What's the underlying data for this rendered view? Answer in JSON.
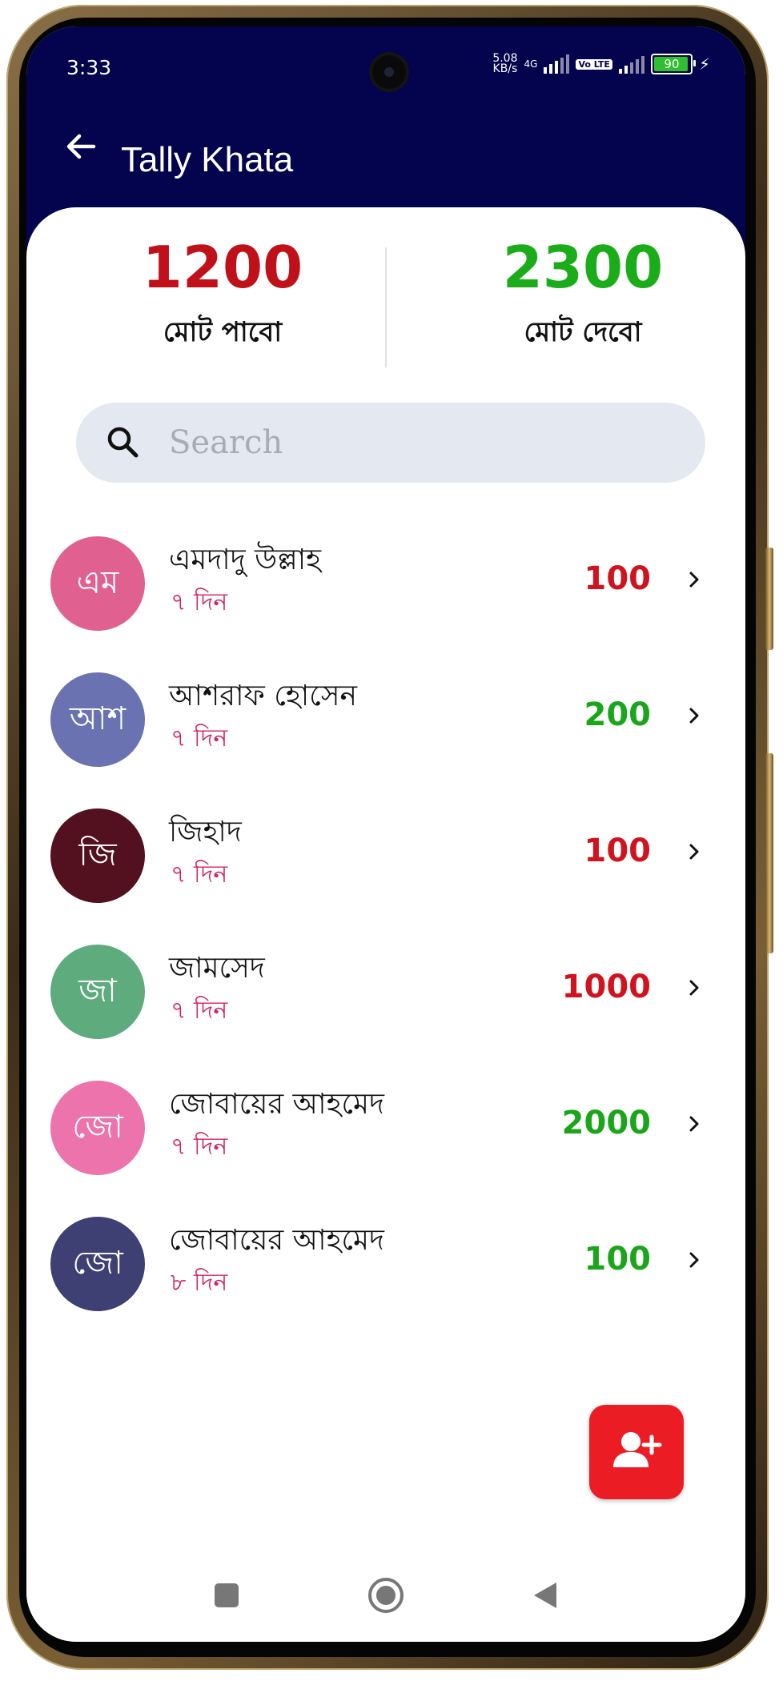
{
  "status": {
    "time": "3:33",
    "speed_top": "5.08",
    "speed_bottom": "KB/s",
    "network": "4G",
    "volte": "Vo LTE",
    "battery": "90"
  },
  "header": {
    "title": "Tally Khata"
  },
  "totals": {
    "receive": {
      "value": "1200",
      "label": "মোট পাবো",
      "color": "#c0101a"
    },
    "give": {
      "value": "2300",
      "label": "মোট দেবো",
      "color": "#1aad19"
    }
  },
  "search": {
    "placeholder": "Search"
  },
  "contacts": [
    {
      "initials": "এম",
      "name": "এমদাদু উল্লাহ",
      "days": "৭ দিন",
      "amount": "100",
      "amount_color": "#d0141f",
      "avatar_color": "#e0618f"
    },
    {
      "initials": "আশ",
      "name": "আশরাফ হোসেন",
      "days": "৭ দিন",
      "amount": "200",
      "amount_color": "#1aa51a",
      "avatar_color": "#6a72b2"
    },
    {
      "initials": "জি",
      "name": "জিহাদ",
      "days": "৭ দিন",
      "amount": "100",
      "amount_color": "#d0141f",
      "avatar_color": "#53101e"
    },
    {
      "initials": "জা",
      "name": "জামসেদ",
      "days": "৭ দিন",
      "amount": "1000",
      "amount_color": "#d0141f",
      "avatar_color": "#5eab7d"
    },
    {
      "initials": "জো",
      "name": "জোবায়ের আহমেদ",
      "days": "৭ দিন",
      "amount": "2000",
      "amount_color": "#1aa51a",
      "avatar_color": "#ec73ac"
    },
    {
      "initials": "জো",
      "name": "জোবায়ের আহমেদ",
      "days": "৮ দিন",
      "amount": "100",
      "amount_color": "#1aa51a",
      "avatar_color": "#3e3f73"
    }
  ],
  "icons": {
    "back": "arrow-left-icon",
    "search": "search-icon",
    "chevron": "chevron-right-icon",
    "fab": "add-user-icon"
  },
  "colors": {
    "topbar": "#03034e",
    "fab": "#ec1c24",
    "search_bg": "#e3e8f1"
  }
}
